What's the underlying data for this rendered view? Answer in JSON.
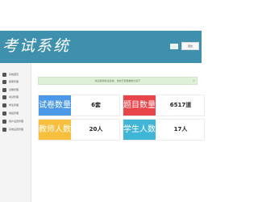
{
  "header": {
    "title": "考试系统",
    "logout_label": "退出"
  },
  "sidebar": {
    "items": [
      {
        "label": "系统首页"
      },
      {
        "label": "题库管理"
      },
      {
        "label": "试卷管理"
      },
      {
        "label": "考试管理"
      },
      {
        "label": "学生管理"
      },
      {
        "label": "成绩管理"
      },
      {
        "label": "用户设置管理"
      },
      {
        "label": "系统设置管理"
      }
    ]
  },
  "notice": {
    "text": "欢迎使用考试系统，当前已有数据统计如下",
    "close": "×"
  },
  "stats": [
    {
      "label": "试卷数量",
      "value": "6套",
      "color": "#4a98e6"
    },
    {
      "label": "题目数量",
      "value": "6517道",
      "color": "#e8454a"
    },
    {
      "label": "教师人数",
      "value": "20人",
      "color": "#f6bf3e"
    },
    {
      "label": "学生人数",
      "value": "17人",
      "color": "#41b5d6"
    }
  ]
}
